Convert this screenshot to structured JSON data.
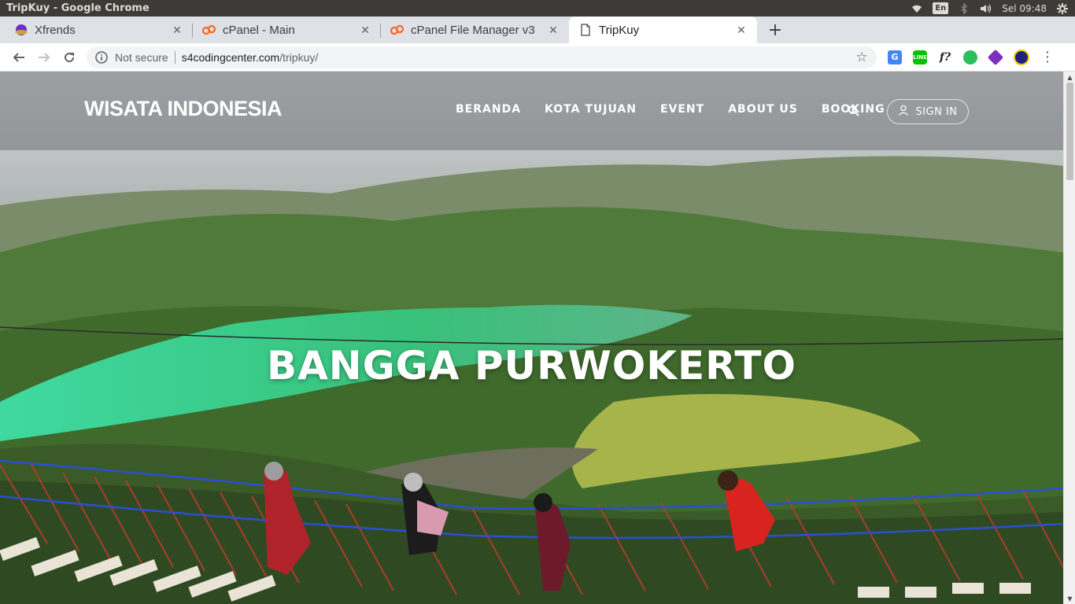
{
  "os": {
    "window_title": "TripKuy - Google Chrome",
    "keyboard_layout": "En",
    "clock": "Sel 09:48"
  },
  "tabs": [
    {
      "title": "Xfrends",
      "icon": "xfrends-favicon"
    },
    {
      "title": "cPanel - Main",
      "icon": "cpanel-favicon"
    },
    {
      "title": "cPanel File Manager v3",
      "icon": "cpanel-favicon"
    },
    {
      "title": "TripKuy",
      "icon": "document-icon",
      "active": true
    }
  ],
  "toolbar": {
    "security_label": "Not secure",
    "url_host": "s4codingcenter.com",
    "url_path": "/tripkuy/"
  },
  "site": {
    "brand": "WISATA INDONESIA",
    "menu": [
      "BERANDA",
      "KOTA TUJUAN",
      "EVENT",
      "ABOUT US",
      "BOOKING"
    ],
    "signin_label": "SIGN IN",
    "headline": "BANGGA PURWOKERTO"
  },
  "colors": {
    "nav_overlay": "#6e7176",
    "cpanel_orange": "#ff6c2c",
    "os_bar": "#3c3b37"
  }
}
